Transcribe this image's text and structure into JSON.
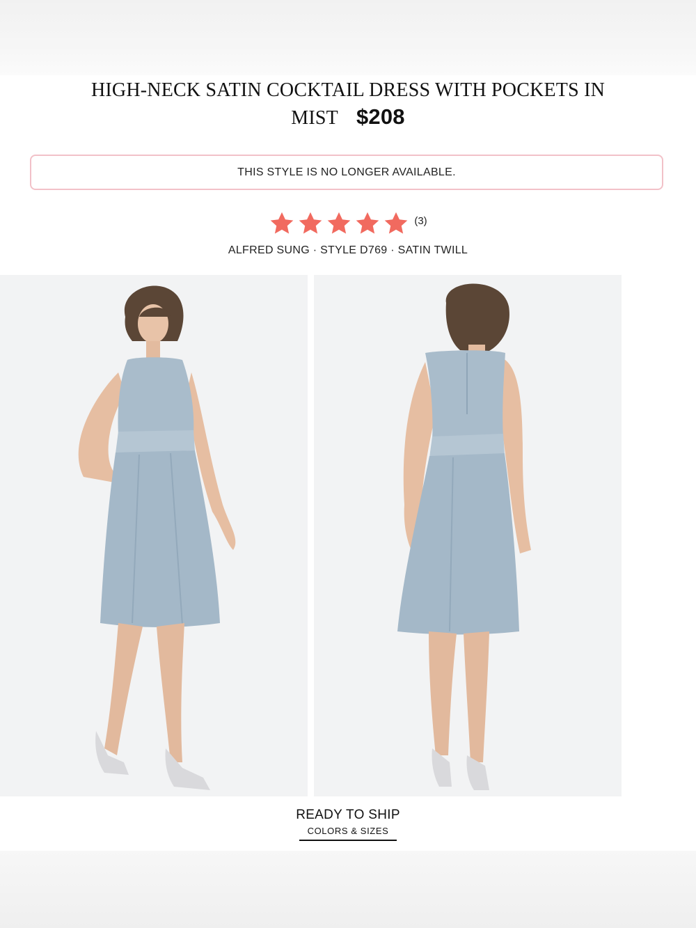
{
  "product": {
    "title": "HIGH-NECK SATIN COCKTAIL DRESS WITH POCKETS IN MIST",
    "price": "$208"
  },
  "notice": {
    "text": "THIS STYLE IS NO LONGER AVAILABLE."
  },
  "rating": {
    "stars": 5,
    "count": "(3)",
    "star_color": "#f16a5f"
  },
  "meta": {
    "line": "ALFRED SUNG · STYLE D769 · SATIN TWILL"
  },
  "colors": {
    "dress_mist": "#a9bccb",
    "notice_border": "#f2c1c8"
  },
  "ship": {
    "title": "READY TO SHIP",
    "link": "COLORS & SIZES"
  }
}
